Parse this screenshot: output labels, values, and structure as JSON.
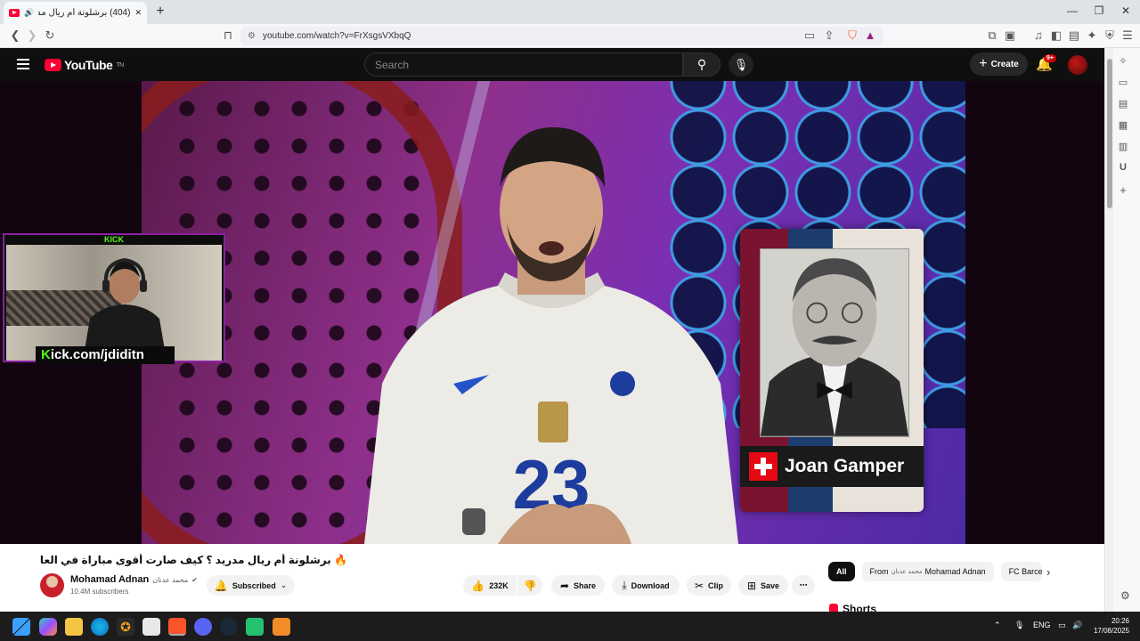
{
  "browser": {
    "tab_title": "(404) برشلونة أم ريال مدريد ؟",
    "url": "youtube.com/watch?v=FrXsgsVXbqQ",
    "new_tab": "+",
    "win_min": "—",
    "win_max": "❐",
    "win_close": "✕"
  },
  "youtube": {
    "logo_text": "YouTube",
    "region": "TN",
    "search_placeholder": "Search",
    "create_label": "Create",
    "notifications_badge": "9+"
  },
  "video": {
    "overlay_kick_label": "KICK",
    "overlay_url_k": "K",
    "overlay_url_rest": "ick.com/jdiditn",
    "card_name": "Joan Gamper",
    "title": "🔥 برشلونة أم ريال مدريد ؟ كيف صارت أقوى مباراة في العالم ؟ - القصة الكاملة",
    "channel_name": "Mohamad Adnan",
    "channel_name_ar": "محمد عدنان",
    "verified": "✔",
    "subscribers": "10.4M subscribers",
    "subscribed_label": "Subscribed",
    "likes": "232K",
    "share_label": "Share",
    "download_label": "Download",
    "clip_label": "Clip",
    "save_label": "Save",
    "more_label": "⋯"
  },
  "chips": {
    "all": "All",
    "from_prefix": "From",
    "from_ar": "محمد عدنان",
    "from_name": "Mohamad Adnan",
    "fc": "FC Barce"
  },
  "shorts_label": "Shorts",
  "taskbar": {
    "lang": "ENG",
    "time": "20:26",
    "date": "17/08/2025"
  },
  "colors": {
    "yt_red": "#ff0033",
    "kick_green": "#53fc18",
    "overlay_border": "#8b1fa5"
  }
}
